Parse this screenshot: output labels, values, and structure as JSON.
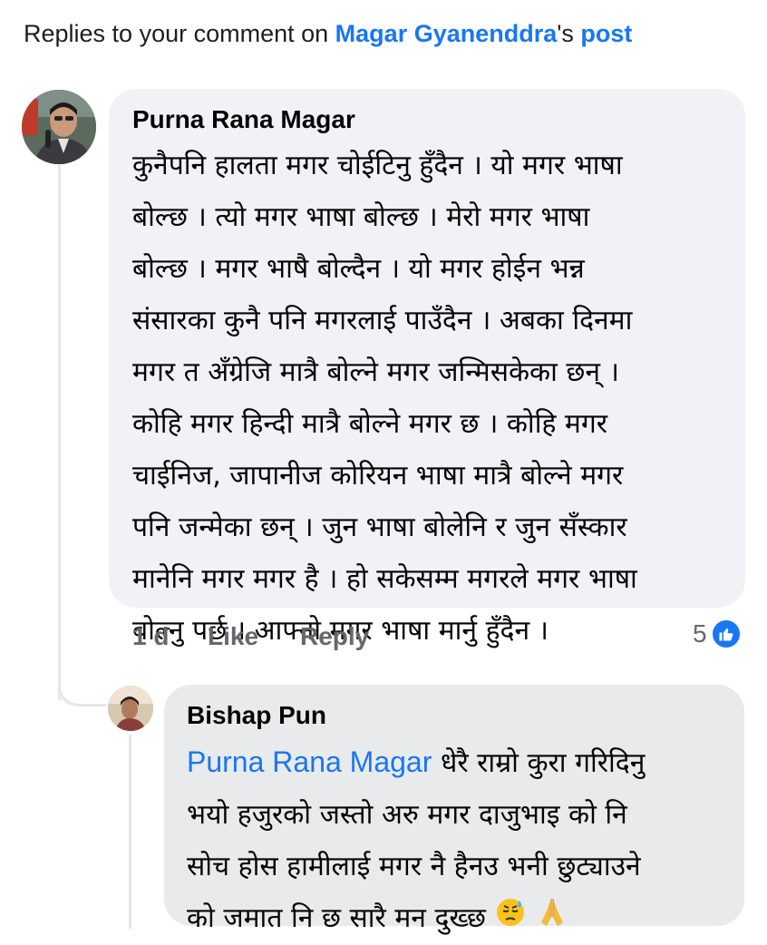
{
  "header": {
    "prefix": "Replies to your comment on ",
    "post_author": "Magar Gyanenddra",
    "possessive": "'s ",
    "post_link": "post"
  },
  "comment": {
    "author": "Purna Rana Magar",
    "lines": [
      "कुनैपनि हालता मगर चोईटिनु हुँदैन । यो मगर भाषा",
      "बोल्छ । त्यो मगर भाषा बोल्छ । मेरो मगर भाषा",
      "बोल्छ । मगर भाषै बोल्दैन । यो मगर होईन भन्न",
      "संसारका कुनै पनि मगरलाई पाउँदैन । अबका दिनमा",
      "मगर त अँग्रेजि मात्रै बोल्ने मगर जन्मिसकेका छन्  ।",
      "कोहि मगर हिन्दी मात्रै बोल्ने मगर छ । कोहि मगर",
      "चाईनिज, जापानीज कोरियन भाषा मात्रै बोल्ने मगर",
      "पनि जन्मेका छन् । जुन भाषा बोलेनि र जुन सँस्कार",
      "मानेनि मगर मगर है । हो सकेसम्म मगरले मगर भाषा",
      "बोल्नु पर्छ । आफ्नो मगर भाषा मार्नु हुँदैन ।"
    ],
    "time": "1 d",
    "like_label": "Like",
    "reply_label": "Reply",
    "reaction_count": "5",
    "reaction_icon": "like-icon"
  },
  "reply": {
    "author": "Bishap Pun",
    "mention": "Purna Rana Magar",
    "line1_rest": " धेरै राम्रो कुरा गरिदिनु",
    "lines": [
      "भयो हजुरको जस्तो  अरु मगर दाजुभाइ को नि",
      "सोच होस हामीलाई मगर नै हैनउ भनी छुट्याउने",
      "को जमात नि छ सारै मन दुख्छ"
    ],
    "emojis": [
      "downcast-sweat-face-icon",
      "folded-hands-icon"
    ]
  },
  "colors": {
    "link": "#1877f2",
    "bubble": "#f0f2f5",
    "meta": "#65676b"
  }
}
